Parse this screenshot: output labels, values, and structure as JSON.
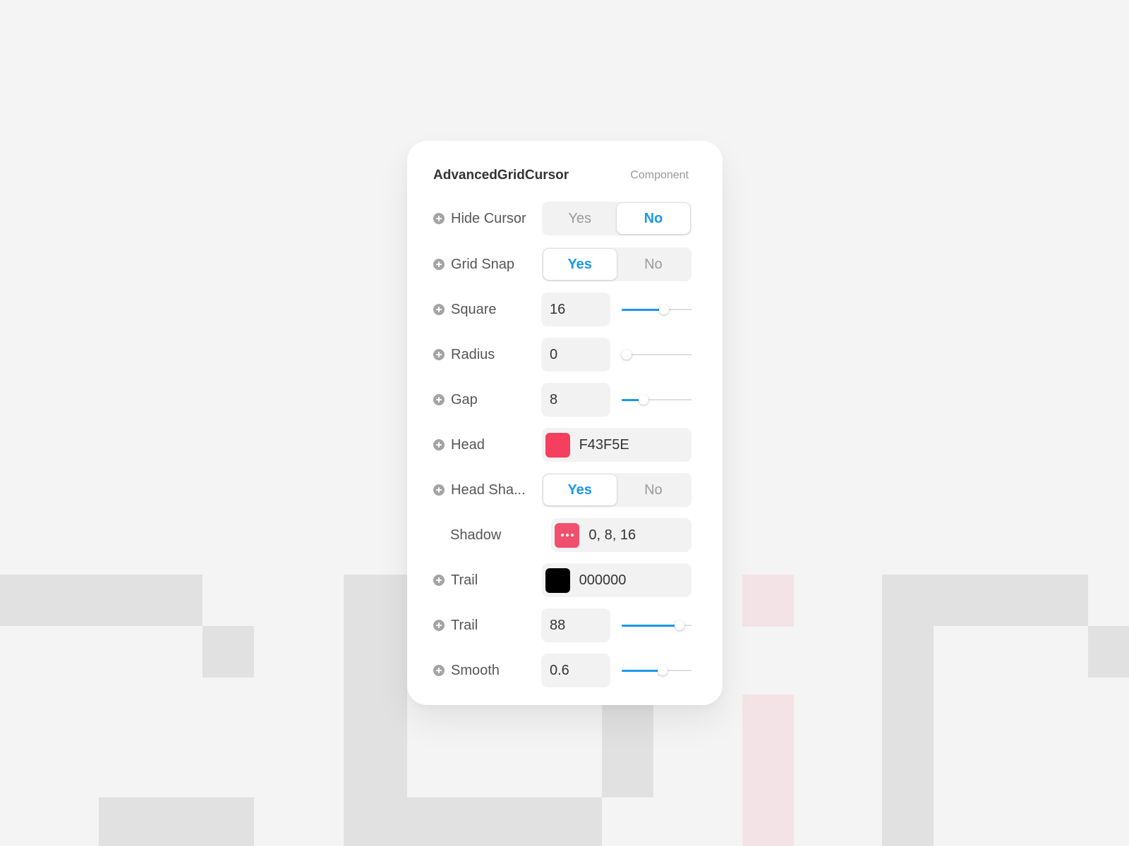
{
  "panel": {
    "title": "AdvancedGridCursor",
    "subtitle": "Component"
  },
  "rows": {
    "hide_cursor": {
      "label": "Hide Cursor",
      "yes": "Yes",
      "no": "No",
      "selected": "No"
    },
    "grid_snap": {
      "label": "Grid Snap",
      "yes": "Yes",
      "no": "No",
      "selected": "Yes"
    },
    "square": {
      "label": "Square",
      "value": "16",
      "slider_fraction": 0.62
    },
    "radius": {
      "label": "Radius",
      "value": "0",
      "slider_fraction": 0.0
    },
    "gap": {
      "label": "Gap",
      "value": "8",
      "slider_fraction": 0.28
    },
    "head": {
      "label": "Head",
      "value": "F43F5E",
      "color": "#F43F5E"
    },
    "head_shadow": {
      "label": "Head Sha...",
      "yes": "Yes",
      "no": "No",
      "selected": "Yes"
    },
    "shadow": {
      "label": "Shadow",
      "value": "0, 8, 16",
      "color": "#F0506E",
      "icon": "more-dots-icon"
    },
    "trail_color": {
      "label": "Trail",
      "value": "000000",
      "color": "#000000"
    },
    "trail_length": {
      "label": "Trail",
      "value": "88",
      "slider_fraction": 0.88
    },
    "smooth": {
      "label": "Smooth",
      "value": "0.6",
      "slider_fraction": 0.6
    }
  },
  "colors": {
    "accent": "#1A98E8",
    "background": "#F4F4F4",
    "background_blocks": "#E1E1E1",
    "background_blocks_pink": "#F4E3E6"
  },
  "icons": [
    "plus-circle-icon",
    "more-dots-icon"
  ]
}
